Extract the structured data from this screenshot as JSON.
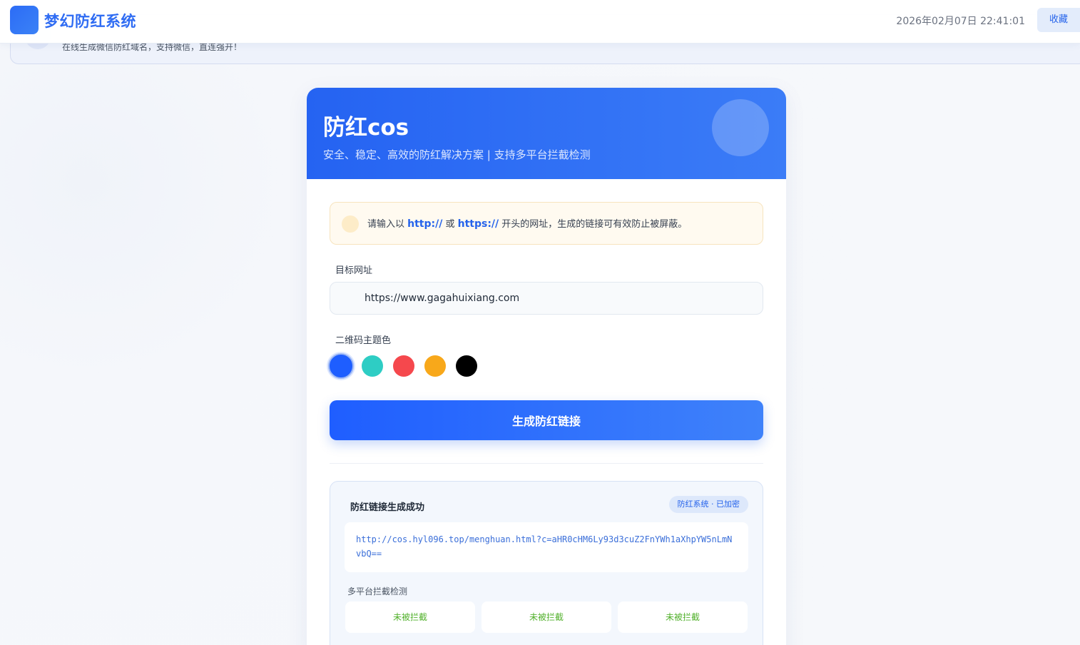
{
  "navbar": {
    "brand": "梦幻防红系统",
    "datetime": "2026年02月07日 22:41:01",
    "favorite_label": "收藏"
  },
  "banner": {
    "text": "在线生成微信防红域名，支持微信，直连强开！"
  },
  "card": {
    "title": "防红cos",
    "subtitle": "安全、稳定、高效的防红解决方案 | 支持多平台拦截检测"
  },
  "notice": {
    "prefix": "请输入以 ",
    "http": "http://",
    "or": " 或 ",
    "https": "https://",
    "suffix": " 开头的网址，生成的链接可有效防止被屏蔽。"
  },
  "form": {
    "url_label": "目标网址",
    "url_value": "https://www.gagahuixiang.com",
    "color_label": "二维码主题色",
    "colors": [
      "#1e5eff",
      "#2ecdc4",
      "#f5484d",
      "#f8a81a",
      "#000000"
    ],
    "selected_color_index": 0,
    "generate_label": "生成防红链接"
  },
  "result": {
    "title": "防红链接生成成功",
    "badge": "防红系统 · 已加密",
    "url": "http://cos.hyl096.top/menghuan.html?c=aHR0cHM6Ly93d3cuZ2FnYWh1aXhpYW5nLmNvbQ==",
    "detect_label": "多平台拦截检测",
    "platforms": [
      {
        "status": "未被拦截"
      },
      {
        "status": "未被拦截"
      },
      {
        "status": "未被拦截"
      }
    ]
  }
}
